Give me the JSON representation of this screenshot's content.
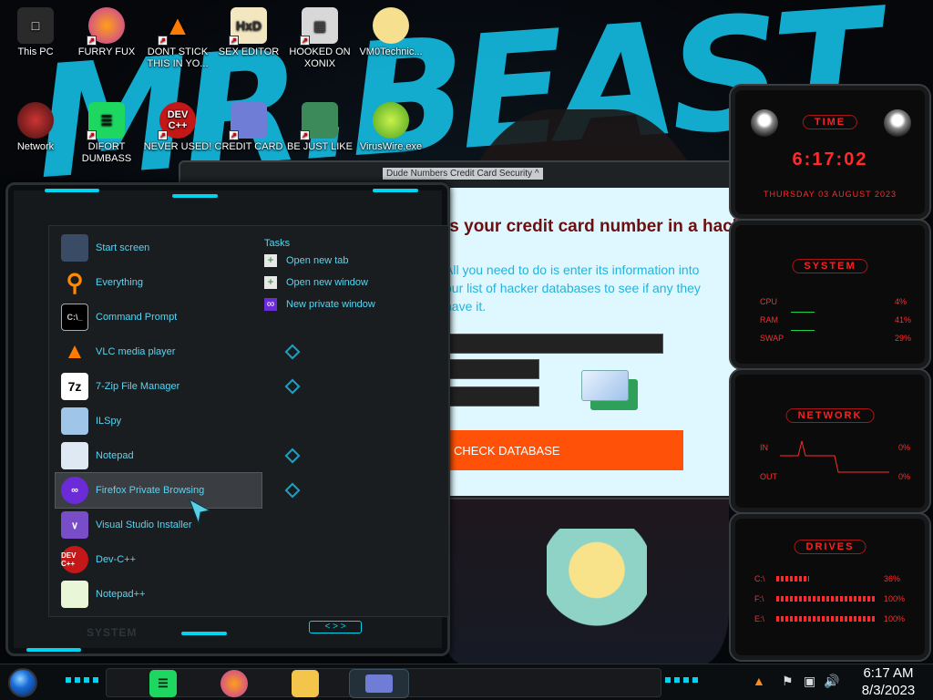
{
  "desktop": {
    "icons": [
      {
        "label": "This PC"
      },
      {
        "label": "FURRY FUX"
      },
      {
        "label": "DONT STICK THIS IN YO..."
      },
      {
        "label": "SEX EDITOR"
      },
      {
        "label": "HOOKED ON XONIX"
      },
      {
        "label": "VM0Technic..."
      },
      {
        "label": "Network"
      },
      {
        "label": "DIFORT DUMBASS"
      },
      {
        "label": "NEVER USED!"
      },
      {
        "label": "CREDIT CARD"
      },
      {
        "label": "BE JUST LIKE"
      },
      {
        "label": "VirusWire.exe"
      }
    ],
    "dev_icon_text": "DEV C++"
  },
  "start_menu": {
    "items": [
      {
        "label": "Start screen",
        "icon": "start-screen-icon"
      },
      {
        "label": "Everything",
        "icon": "magnifier-icon"
      },
      {
        "label": "Command Prompt",
        "icon": "terminal-icon",
        "icon_text": "C:\\_"
      },
      {
        "label": "VLC media player",
        "icon": "vlc-cone-icon"
      },
      {
        "label": "7-Zip File Manager",
        "icon": "seven-zip-icon",
        "icon_text": "7z"
      },
      {
        "label": "ILSpy",
        "icon": "ilspy-icon"
      },
      {
        "label": "Notepad",
        "icon": "notepad-icon"
      },
      {
        "label": "Firefox Private Browsing",
        "icon": "private-browsing-icon"
      },
      {
        "label": "Visual Studio Installer",
        "icon": "visual-studio-icon"
      },
      {
        "label": "Dev-C++",
        "icon": "devcpp-icon",
        "icon_text": "DEV C++"
      },
      {
        "label": "Notepad++",
        "icon": "notepadpp-icon"
      }
    ],
    "tasks_heading": "Tasks",
    "tasks": [
      {
        "label": "Open new tab"
      },
      {
        "label": "Open new window"
      },
      {
        "label": "New private window"
      }
    ],
    "footer_label": "SYSTEM",
    "nav_arrows": "< > >"
  },
  "browser": {
    "window_title": "Dude Numbers Credit Card Security ^",
    "heading": "Is your credit card number in a hacker's database?",
    "body": "All you need to do is enter its information into our list of hacker databases to see if any they have it.",
    "button_label": "CHECK DATABASE"
  },
  "hud": {
    "time": {
      "title": "TIME",
      "value": "6:17:02",
      "date": "THURSDAY 03 AUGUST 2023"
    },
    "system": {
      "title": "SYSTEM",
      "rows": [
        {
          "label": "CPU",
          "value": "4%"
        },
        {
          "label": "RAM",
          "value": "41%"
        },
        {
          "label": "SWAP",
          "value": "29%"
        }
      ]
    },
    "network": {
      "title": "NETWORK",
      "rows": [
        {
          "label": "IN",
          "value": "0%"
        },
        {
          "label": "OUT",
          "value": "0%"
        }
      ]
    },
    "drives": {
      "title": "DRIVES",
      "rows": [
        {
          "label": "C:\\",
          "value": "36%"
        },
        {
          "label": "F:\\",
          "value": "100%"
        },
        {
          "label": "E:\\",
          "value": "100%"
        }
      ]
    }
  },
  "taskbar": {
    "apps": [
      {
        "name": "notes-app-icon",
        "active": false
      },
      {
        "name": "firefox-icon",
        "active": false
      },
      {
        "name": "file-explorer-icon",
        "active": false
      },
      {
        "name": "credit-card-app-icon",
        "active": true
      }
    ],
    "clock": {
      "time": "6:17 AM",
      "date": "8/3/2023"
    }
  },
  "colors": {
    "accent": "#00d4f0",
    "hud_red": "#ff2b2b",
    "button_orange": "#ff5208",
    "heading_red": "#6a1010",
    "text_cyan": "#56d6f5"
  }
}
